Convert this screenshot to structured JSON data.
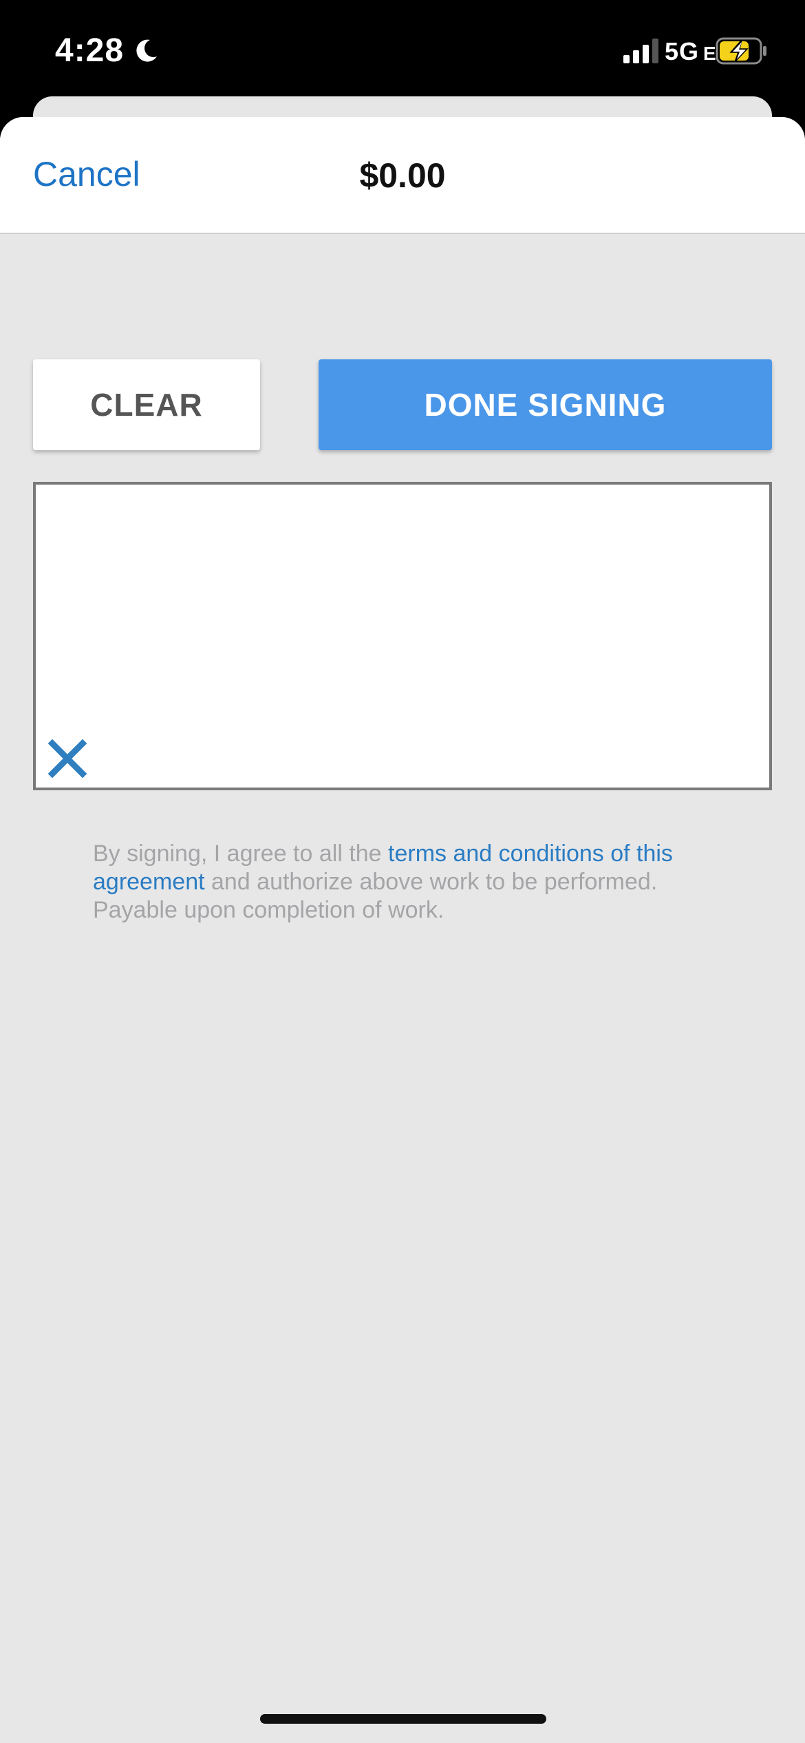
{
  "status_bar": {
    "time": "4:28",
    "network": "5G",
    "network_suffix": "E",
    "icons": [
      "moon-icon",
      "signal-icon",
      "battery-charging-icon"
    ]
  },
  "nav": {
    "cancel_label": "Cancel",
    "title": "$0.00"
  },
  "actions": {
    "clear_label": "CLEAR",
    "done_label": "DONE SIGNING"
  },
  "signature": {
    "clear_icon": "close-x-icon"
  },
  "agreement": {
    "prefix": "By signing, I agree to all the ",
    "link_text": "terms and conditions of this agreement",
    "suffix": " and authorize above work to be performed. Payable upon completion of work."
  },
  "colors": {
    "accent": "#1d74c6",
    "primary_button": "#4a97ea",
    "background": "#e7e7e8",
    "battery": "#f5d21a"
  }
}
